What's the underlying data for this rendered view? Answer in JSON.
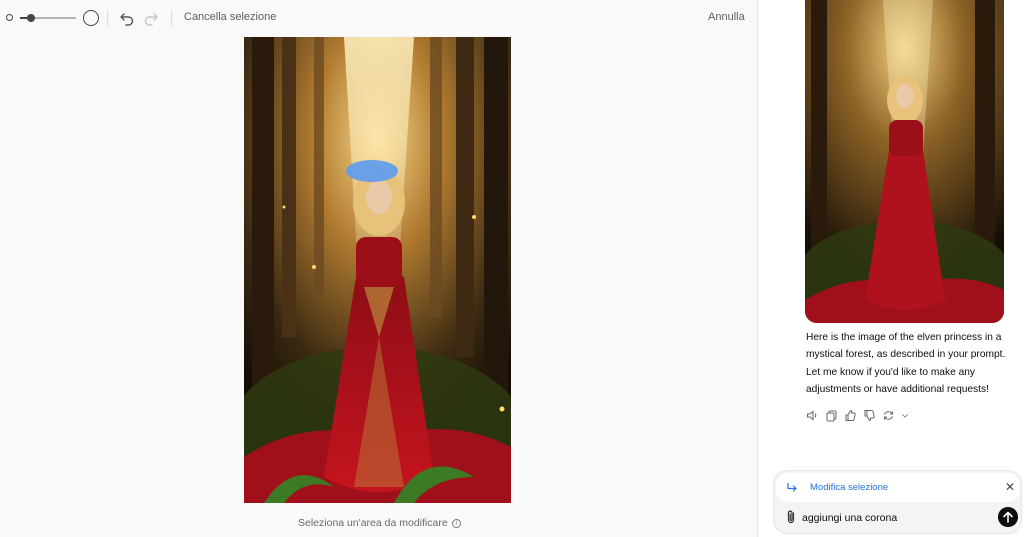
{
  "toolbar": {
    "clear_selection_label": "Cancella selezione",
    "cancel_label": "Annulla",
    "brush_size_fraction": 0.2
  },
  "editor": {
    "hint_text": "Seleziona un'area da modificare"
  },
  "chat": {
    "assistant_message": "Here is the image of the elven princess in a mystical forest, as described in your prompt. Let me know if you'd like to make any adjustments or have additional requests!",
    "action_icons": [
      "speaker-icon",
      "copy-icon",
      "thumbs-up-icon",
      "thumbs-down-icon",
      "regenerate-icon"
    ]
  },
  "composer": {
    "selection_label": "Modifica selezione",
    "input_value": "aggiungi una corona"
  },
  "colors": {
    "accent": "#2472e0",
    "mask": "#5b9bf0",
    "dress": "#a8101c"
  }
}
